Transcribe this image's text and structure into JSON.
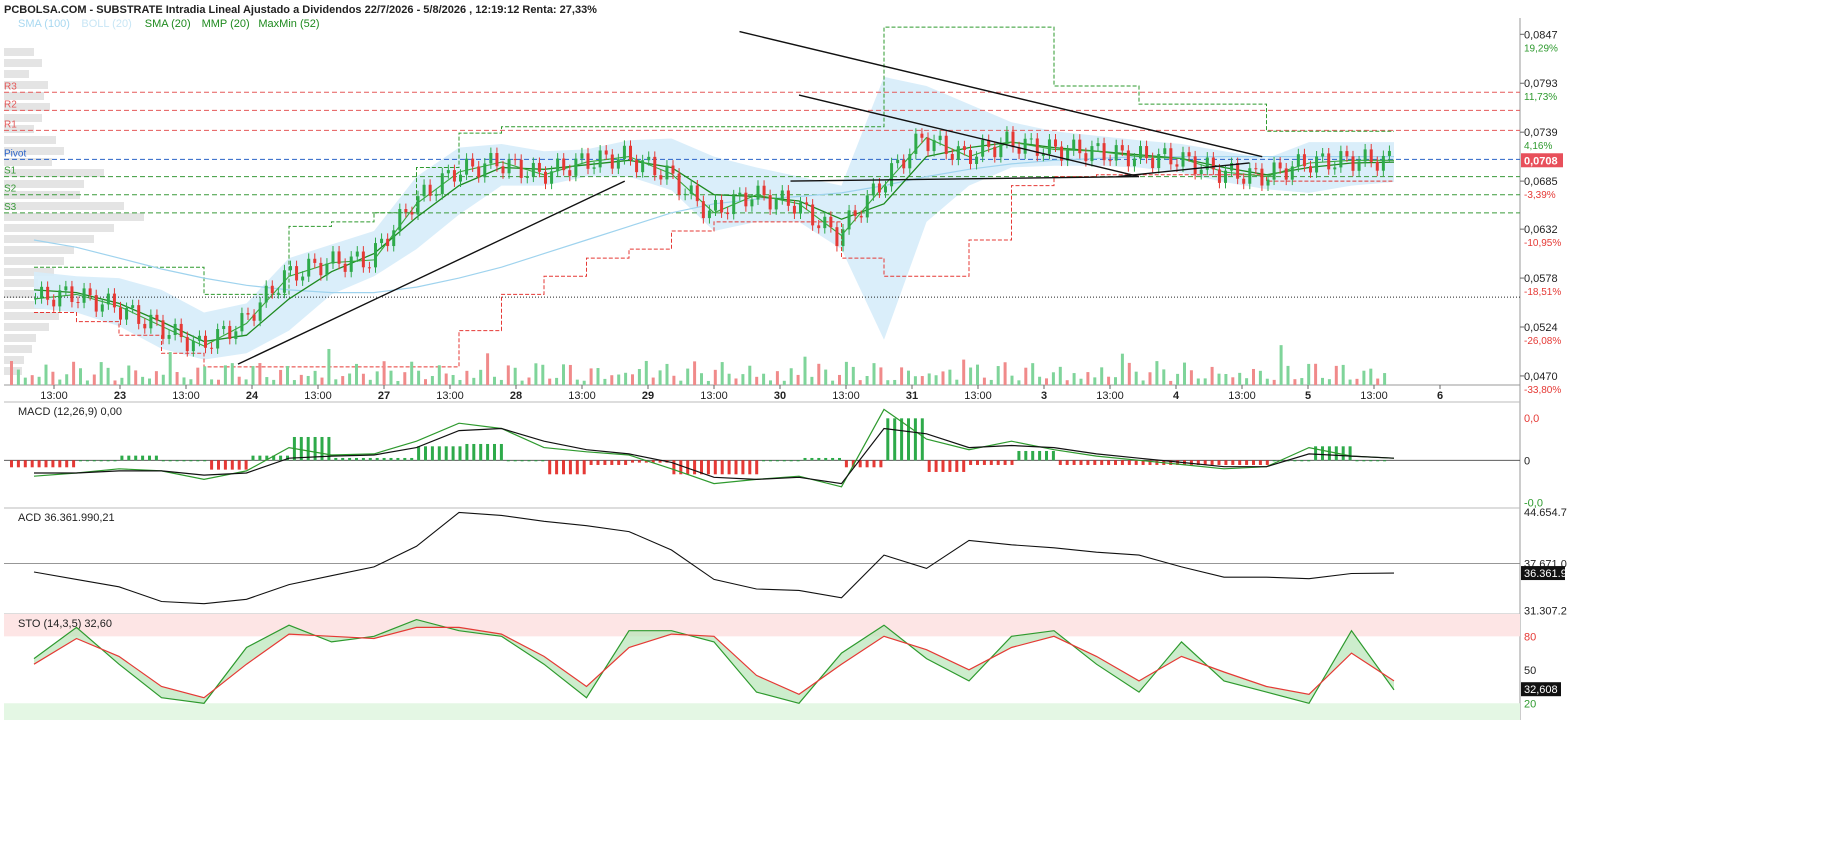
{
  "header": {
    "title": "PCBOLSA.COM - SUBSTRATE Intradia Lineal Ajustado a Dividendos 22/7/2026 - 5/8/2026 , 12:19:12 Renta: 27,33%"
  },
  "legend": [
    {
      "label": "SMA (100)",
      "color": "#a8d8f0"
    },
    {
      "label": "BOLL (20)",
      "color": "#c8e6f5"
    },
    {
      "label": "SMA (20)",
      "color": "#1e8a1e"
    },
    {
      "label": "MMP (20)",
      "color": "#1e8a1e"
    },
    {
      "label": "MaxMin (52)",
      "color": "#1e8a1e"
    }
  ],
  "colors": {
    "up": "#2eaa4a",
    "down": "#e53935",
    "boll": "#d6ecfa",
    "sma100": "#9fd3ee",
    "pivot": "#2a63c8",
    "resistance": "#e55a5a",
    "support": "#3a9a3a",
    "last_price_bg": "#e8505b"
  },
  "chart_data": [
    {
      "type": "candlestick",
      "title": "PCBOLSA.COM - SUBSTRATE Intradia Lineal Ajustado a Dividendos 22/7/2026 - 5/8/2026 , 12:19:12 Renta: 27,33%",
      "x_ticks": [
        "13:00",
        "23",
        "13:00",
        "24",
        "13:00",
        "27",
        "13:00",
        "28",
        "13:00",
        "29",
        "13:00",
        "30",
        "13:00",
        "31",
        "13:00",
        "3",
        "13:00",
        "4",
        "13:00",
        "5",
        "13:00",
        "6"
      ],
      "y_ticks": [
        "0,0847",
        "0,0793",
        "0,0739",
        "0,0685",
        "0,0632",
        "0,0578",
        "0,0524",
        "0,0470"
      ],
      "y_tick_values": [
        0.0847,
        0.0793,
        0.0739,
        0.0685,
        0.0632,
        0.0578,
        0.0524,
        0.047
      ],
      "percent_ticks": [
        "19,29%",
        "11,73%",
        "4,16%",
        "-3,39%",
        "-10,95%",
        "-18,51%",
        "-26,08%",
        "-33,80%"
      ],
      "percent_values": [
        0.0847,
        0.0793,
        0.0739,
        0.0685,
        0.0632,
        0.0578,
        0.0524,
        0.047
      ],
      "ylim": [
        0.046,
        0.0865
      ],
      "last_price": "0,0708",
      "last_price_value": 0.0708,
      "levels": [
        {
          "label": "R3",
          "value": 0.0783,
          "kind": "resistance"
        },
        {
          "label": "R2",
          "value": 0.0763,
          "kind": "resistance"
        },
        {
          "label": "R1",
          "value": 0.0741,
          "kind": "resistance"
        },
        {
          "label": "Pivot",
          "value": 0.0709,
          "kind": "pivot"
        },
        {
          "label": "S1",
          "value": 0.069,
          "kind": "support"
        },
        {
          "label": "S2",
          "value": 0.067,
          "kind": "support"
        },
        {
          "label": "S3",
          "value": 0.065,
          "kind": "support"
        }
      ],
      "prev_close_value": 0.0557,
      "series_x": [
        0,
        5,
        10,
        15,
        20,
        25,
        30,
        35,
        40,
        45,
        50,
        55,
        60,
        65,
        70,
        75,
        80,
        85,
        90,
        95,
        100,
        105,
        110,
        115,
        120,
        125,
        130,
        135,
        140,
        145,
        150,
        155,
        160
      ],
      "close": [
        0.0555,
        0.056,
        0.0547,
        0.0525,
        0.0503,
        0.0528,
        0.058,
        0.0595,
        0.0598,
        0.066,
        0.0695,
        0.0706,
        0.0692,
        0.0706,
        0.0712,
        0.0693,
        0.065,
        0.067,
        0.066,
        0.0625,
        0.068,
        0.0733,
        0.0712,
        0.0728,
        0.072,
        0.0718,
        0.0712,
        0.071,
        0.0695,
        0.069,
        0.0705,
        0.0708,
        0.0708
      ],
      "sma20": [
        0.0565,
        0.0562,
        0.055,
        0.053,
        0.0508,
        0.0515,
        0.0555,
        0.0585,
        0.0605,
        0.0645,
        0.068,
        0.07,
        0.0698,
        0.0703,
        0.0708,
        0.07,
        0.067,
        0.0668,
        0.0663,
        0.0643,
        0.066,
        0.0712,
        0.0722,
        0.0728,
        0.0722,
        0.0718,
        0.0714,
        0.071,
        0.07,
        0.0692,
        0.07,
        0.0705,
        0.0706
      ],
      "boll_upper": [
        0.0585,
        0.058,
        0.0578,
        0.0565,
        0.054,
        0.055,
        0.06,
        0.0615,
        0.063,
        0.069,
        0.0722,
        0.0726,
        0.0718,
        0.072,
        0.073,
        0.0732,
        0.0712,
        0.07,
        0.069,
        0.068,
        0.08,
        0.079,
        0.077,
        0.075,
        0.074,
        0.0735,
        0.073,
        0.0726,
        0.0718,
        0.071,
        0.0728,
        0.0728,
        0.0728
      ],
      "boll_lower": [
        0.0545,
        0.054,
        0.0525,
        0.05,
        0.0488,
        0.0495,
        0.052,
        0.056,
        0.058,
        0.061,
        0.0648,
        0.068,
        0.068,
        0.069,
        0.069,
        0.0675,
        0.063,
        0.064,
        0.064,
        0.061,
        0.051,
        0.064,
        0.068,
        0.07,
        0.0702,
        0.0702,
        0.07,
        0.0694,
        0.0684,
        0.0676,
        0.0672,
        0.068,
        0.0684
      ],
      "sma100": [
        0.062,
        0.0612,
        0.06,
        0.0588,
        0.0578,
        0.057,
        0.0565,
        0.0562,
        0.0562,
        0.0568,
        0.0578,
        0.059,
        0.0605,
        0.062,
        0.0635,
        0.065,
        0.066,
        0.0665,
        0.0668,
        0.0672,
        0.068,
        0.069,
        0.0698,
        0.0704,
        0.0708,
        0.071,
        0.0712,
        0.0712,
        0.0712,
        0.0712,
        0.0712,
        0.0712,
        0.0712
      ],
      "maxmin_upper": [
        0.059,
        0.059,
        0.059,
        0.059,
        0.056,
        0.056,
        0.0635,
        0.064,
        0.065,
        0.07,
        0.0738,
        0.0745,
        0.0745,
        0.0745,
        0.0745,
        0.0745,
        0.0745,
        0.0745,
        0.0745,
        0.0745,
        0.0855,
        0.0855,
        0.0855,
        0.0855,
        0.079,
        0.079,
        0.077,
        0.077,
        0.077,
        0.074,
        0.074,
        0.074,
        0.074
      ],
      "maxmin_lower": [
        0.054,
        0.053,
        0.0515,
        0.0495,
        0.048,
        0.048,
        0.048,
        0.048,
        0.048,
        0.048,
        0.052,
        0.056,
        0.058,
        0.06,
        0.061,
        0.063,
        0.064,
        0.064,
        0.064,
        0.06,
        0.058,
        0.058,
        0.062,
        0.068,
        0.069,
        0.0692,
        0.0692,
        0.0692,
        0.0692,
        0.0685,
        0.0685,
        0.0685,
        0.0685
      ],
      "trendlines": [
        {
          "x1": 48,
          "y1": 0.0483,
          "x2": 139,
          "y2": 0.0685,
          "color": "#111111"
        },
        {
          "x1": 166,
          "y1": 0.085,
          "x2": 289,
          "y2": 0.0712,
          "color": "#111111"
        },
        {
          "x1": 180,
          "y1": 0.078,
          "x2": 260,
          "y2": 0.069,
          "color": "#111111"
        },
        {
          "x1": 178,
          "y1": 0.0685,
          "x2": 260,
          "y2": 0.069,
          "color": "#111111"
        },
        {
          "x1": 255,
          "y1": 0.069,
          "x2": 286,
          "y2": 0.0705,
          "color": "#111111"
        }
      ],
      "volume_max": 1.0
    },
    {
      "type": "line",
      "title": "MACD (12,26,9)",
      "value_label": "0,00",
      "y_ticks": [
        "0,0",
        "0",
        "-0,0"
      ],
      "y_tick_values": [
        0.004,
        0.0,
        -0.004
      ],
      "ylim": [
        -0.0045,
        0.0055
      ],
      "macd": [
        -0.0015,
        -0.0012,
        -0.0008,
        -0.001,
        -0.0018,
        -0.001,
        0.0012,
        0.0005,
        0.0006,
        0.0018,
        0.0035,
        0.003,
        0.0012,
        0.0008,
        0.0005,
        -0.0008,
        -0.0022,
        -0.0018,
        -0.0015,
        -0.0025,
        0.0048,
        0.002,
        0.001,
        0.0018,
        0.001,
        0.0004,
        0.0,
        -0.0004,
        -0.0008,
        -0.0006,
        0.0012,
        0.0004,
        0.0002
      ],
      "signal": [
        -0.0012,
        -0.0012,
        -0.001,
        -0.001,
        -0.0014,
        -0.0012,
        0.0002,
        0.0004,
        0.0005,
        0.0012,
        0.0028,
        0.003,
        0.0018,
        0.001,
        0.0006,
        -0.0002,
        -0.0016,
        -0.0018,
        -0.0016,
        -0.0022,
        0.003,
        0.0025,
        0.0012,
        0.0014,
        0.0012,
        0.0006,
        0.0002,
        -0.0002,
        -0.0006,
        -0.0006,
        0.0006,
        0.0004,
        0.0002
      ]
    },
    {
      "type": "line",
      "title": "ACD",
      "value_label": "36.361.990,21",
      "y_ticks": [
        "44.654.7",
        "37.671.0",
        "36.361.9",
        "31.307.2"
      ],
      "y_tick_values": [
        44654700,
        37671000,
        36361990,
        31307200
      ],
      "ylim": [
        30800000,
        45200000
      ],
      "last_value_label": "36.361.9",
      "acd": [
        36500000,
        35500000,
        34500000,
        32500000,
        32200000,
        32800000,
        34800000,
        36000000,
        37200000,
        40000000,
        44600000,
        44200000,
        43400000,
        42800000,
        42000000,
        39500000,
        35500000,
        34200000,
        34000000,
        33000000,
        38800000,
        37000000,
        40800000,
        40200000,
        39800000,
        39200000,
        38800000,
        37200000,
        35800000,
        35800000,
        35600000,
        36300000,
        36361990
      ]
    },
    {
      "type": "line",
      "title": "STO (14,3,5)",
      "value_label": "32,60",
      "y_ticks": [
        "80",
        "50",
        "20"
      ],
      "y_tick_values": [
        80,
        50,
        20
      ],
      "ylim": [
        5,
        100
      ],
      "last_value_label": "32,608",
      "k": [
        60,
        88,
        55,
        25,
        20,
        70,
        90,
        75,
        80,
        95,
        85,
        80,
        55,
        25,
        85,
        85,
        75,
        30,
        20,
        65,
        90,
        60,
        40,
        80,
        85,
        55,
        30,
        75,
        40,
        30,
        20,
        85,
        32
      ],
      "d": [
        55,
        78,
        62,
        35,
        25,
        55,
        82,
        80,
        78,
        88,
        88,
        82,
        62,
        35,
        70,
        82,
        80,
        45,
        28,
        55,
        80,
        68,
        50,
        70,
        80,
        62,
        40,
        62,
        48,
        35,
        28,
        65,
        40
      ]
    }
  ]
}
